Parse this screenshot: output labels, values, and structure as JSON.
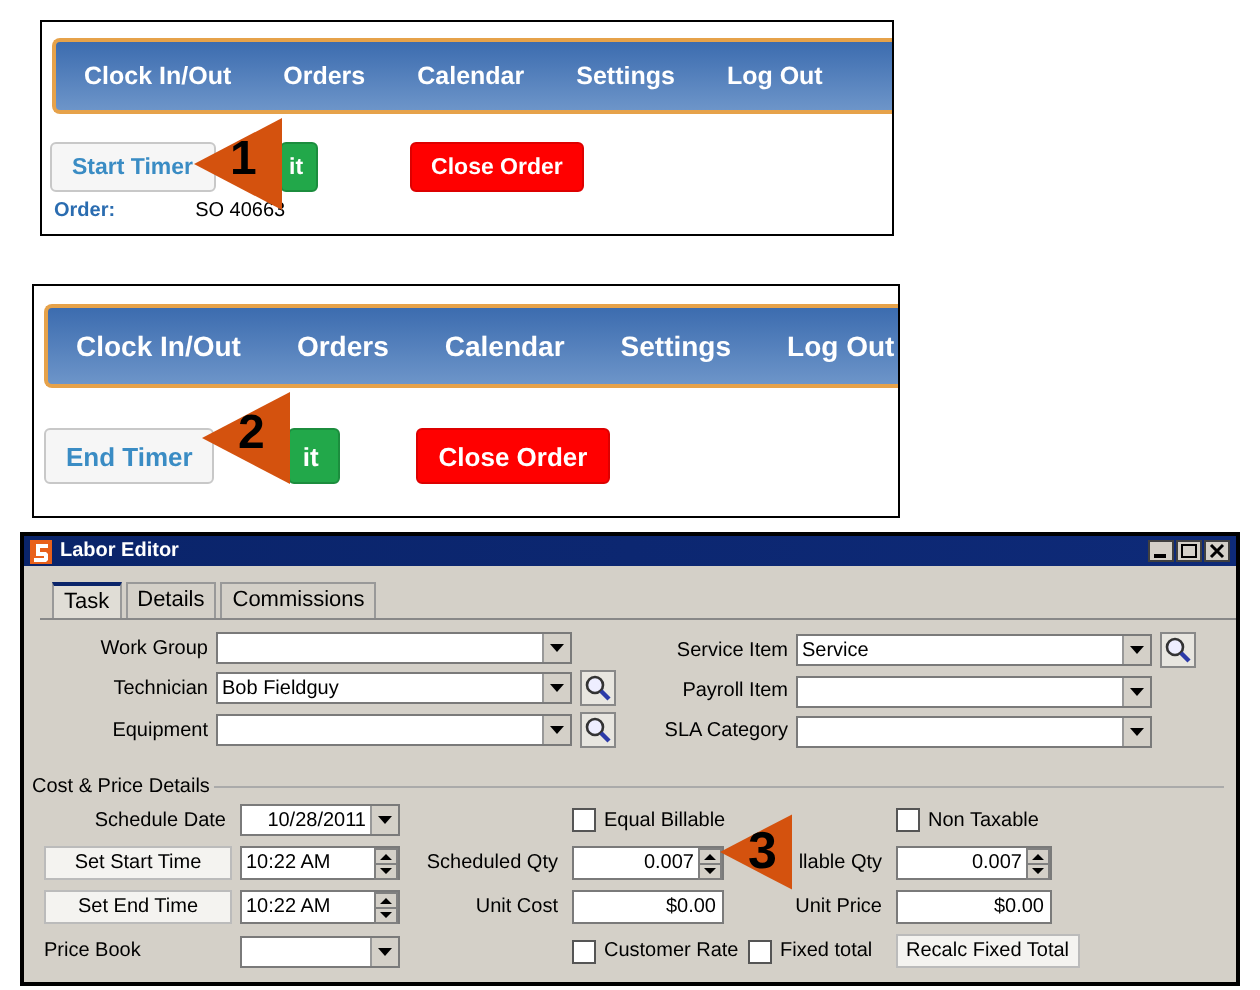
{
  "web_panels": [
    {
      "nav": [
        "Clock In/Out",
        "Orders",
        "Calendar",
        "Settings",
        "Log Out"
      ],
      "buttons": [
        {
          "label": "Start Timer",
          "kind": "light"
        },
        {
          "label": "it",
          "kind": "green"
        },
        {
          "label": "Close Order",
          "kind": "red"
        }
      ],
      "callout": "1",
      "order_label": "Order:",
      "order_value": "SO 40663"
    },
    {
      "nav": [
        "Clock In/Out",
        "Orders",
        "Calendar",
        "Settings",
        "Log Out"
      ],
      "buttons": [
        {
          "label": "End Timer",
          "kind": "light"
        },
        {
          "label": "it",
          "kind": "green"
        },
        {
          "label": "Close Order",
          "kind": "red"
        }
      ],
      "callout": "2"
    }
  ],
  "labor_editor": {
    "title": "Labor Editor",
    "tabs": [
      {
        "label": "Task",
        "selected": true
      },
      {
        "label": "Details",
        "selected": false
      },
      {
        "label": "Commissions",
        "selected": false
      }
    ],
    "left_fields": [
      {
        "label": "Work Group",
        "lookup": false
      },
      {
        "label": "Technician",
        "value": "Bob Fieldguy",
        "lookup": true
      },
      {
        "label": "Equipment",
        "lookup": true
      }
    ],
    "right_fields": [
      {
        "label": "Service Item",
        "value": "Service",
        "lookup": true
      },
      {
        "label": "Payroll Item",
        "lookup": false
      },
      {
        "label": "SLA Category",
        "lookup": false
      }
    ],
    "section": "Cost & Price Details",
    "rows": [
      [
        {
          "kind": "label",
          "text": "Schedule Date"
        },
        {
          "kind": "date",
          "text": "10/28/2011"
        },
        "",
        {
          "kind": "checkbox",
          "text": "Equal Billable",
          "checked": false
        },
        "",
        {
          "kind": "checkbox",
          "text": "Non Taxable",
          "checked": false
        }
      ],
      [
        {
          "kind": "button",
          "text": "Set Start Time"
        },
        {
          "kind": "spin",
          "text": "10:22 AM"
        },
        {
          "kind": "label",
          "text": "Scheduled Qty"
        },
        {
          "kind": "spin",
          "text": "0.007"
        },
        {
          "kind": "label",
          "text": "llable Qty"
        },
        {
          "kind": "spin",
          "text": "0.007"
        }
      ],
      [
        {
          "kind": "button",
          "text": "Set End Time"
        },
        {
          "kind": "spin",
          "text": "10:22 AM"
        },
        {
          "kind": "label",
          "text": "Unit Cost"
        },
        {
          "kind": "text",
          "text": "$0.00"
        },
        {
          "kind": "label",
          "text": "Unit Price"
        },
        {
          "kind": "text",
          "text": "$0.00"
        }
      ],
      [
        {
          "kind": "label",
          "text": "Price Book"
        },
        {
          "kind": "combo"
        },
        "",
        {
          "kind": "checkbox",
          "text": "Customer Rate",
          "checked": false
        },
        {
          "kind": "checkbox",
          "text": "Fixed total",
          "checked": false
        },
        {
          "kind": "button",
          "text": "Recalc Fixed Total"
        }
      ]
    ],
    "callout": "3"
  }
}
